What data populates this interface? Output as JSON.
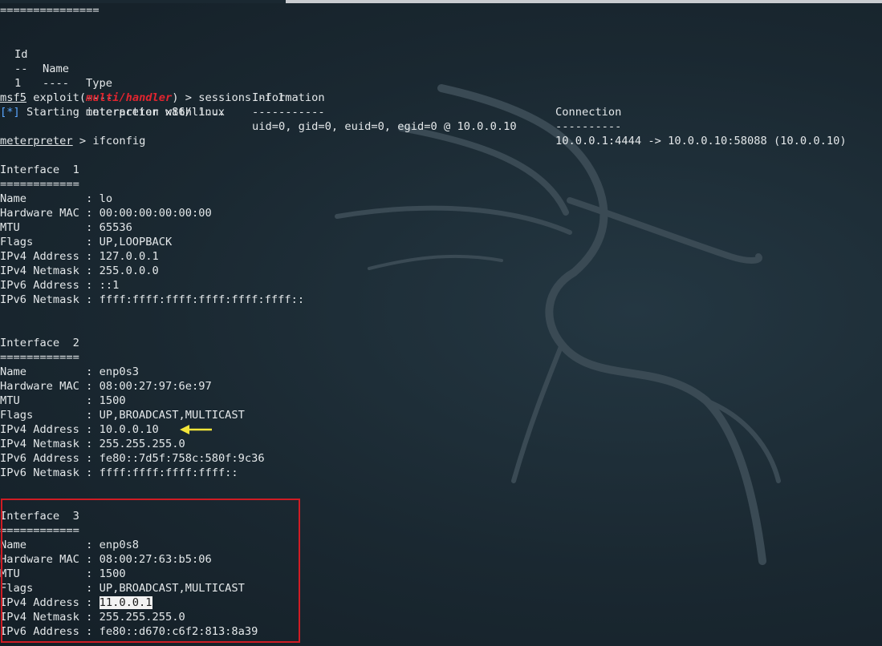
{
  "table": {
    "separator_top": "===============",
    "headers": [
      "Id",
      "Name",
      "Type",
      "Information",
      "Connection"
    ],
    "dashes": [
      "--",
      "----",
      "----",
      "-----------",
      "----------"
    ],
    "rows": [
      [
        "1",
        "",
        "meterpreter x86/linux",
        "uid=0, gid=0, euid=0, egid=0 @ 10.0.0.10",
        "10.0.0.1:4444 -> 10.0.0.10:58088 (10.0.0.10)"
      ]
    ]
  },
  "console": {
    "prompt_prefix": "msf5",
    "prompt_module_open": " exploit(",
    "prompt_module": "multi/handler",
    "prompt_module_close": ") > ",
    "command1": "sessions -i 1",
    "info_prefix": "[*]",
    "info_text": " Starting interaction with 1...",
    "meterpreter_prompt": "meterpreter",
    "meterpreter_sep": " > ",
    "command2": "ifconfig"
  },
  "interfaces": [
    {
      "title": "Interface  1",
      "sep": "============",
      "fields": [
        {
          "label": "Name         : ",
          "value": "lo"
        },
        {
          "label": "Hardware MAC : ",
          "value": "00:00:00:00:00:00"
        },
        {
          "label": "MTU          : ",
          "value": "65536"
        },
        {
          "label": "Flags        : ",
          "value": "UP,LOOPBACK"
        },
        {
          "label": "IPv4 Address : ",
          "value": "127.0.0.1"
        },
        {
          "label": "IPv4 Netmask : ",
          "value": "255.0.0.0"
        },
        {
          "label": "IPv6 Address : ",
          "value": "::1"
        },
        {
          "label": "IPv6 Netmask : ",
          "value": "ffff:ffff:ffff:ffff:ffff:ffff::"
        }
      ]
    },
    {
      "title": "Interface  2",
      "sep": "============",
      "fields": [
        {
          "label": "Name         : ",
          "value": "enp0s3"
        },
        {
          "label": "Hardware MAC : ",
          "value": "08:00:27:97:6e:97"
        },
        {
          "label": "MTU          : ",
          "value": "1500"
        },
        {
          "label": "Flags        : ",
          "value": "UP,BROADCAST,MULTICAST"
        },
        {
          "label": "IPv4 Address : ",
          "value": "10.0.0.10"
        },
        {
          "label": "IPv4 Netmask : ",
          "value": "255.255.255.0"
        },
        {
          "label": "IPv6 Address : ",
          "value": "fe80::7d5f:758c:580f:9c36"
        },
        {
          "label": "IPv6 Netmask : ",
          "value": "ffff:ffff:ffff:ffff::"
        }
      ]
    },
    {
      "title": "Interface  3",
      "sep": "============",
      "fields": [
        {
          "label": "Name         : ",
          "value": "enp0s8"
        },
        {
          "label": "Hardware MAC : ",
          "value": "08:00:27:63:b5:06"
        },
        {
          "label": "MTU          : ",
          "value": "1500"
        },
        {
          "label": "Flags        : ",
          "value": "UP,BROADCAST,MULTICAST"
        },
        {
          "label": "IPv4 Address : ",
          "value": "11.0.0.1"
        },
        {
          "label": "IPv4 Netmask : ",
          "value": "255.255.255.0"
        },
        {
          "label": "IPv6 Address : ",
          "value": "fe80::d670:c6f2:813:8a39"
        }
      ]
    }
  ],
  "colors": {
    "background": "#1b2a34",
    "text": "#e4e8ea",
    "prompt_module": "#e0252f",
    "info_prefix": "#5aa7ff",
    "annotation_box": "#d01c24",
    "annotation_arrow": "#f3e53a"
  }
}
